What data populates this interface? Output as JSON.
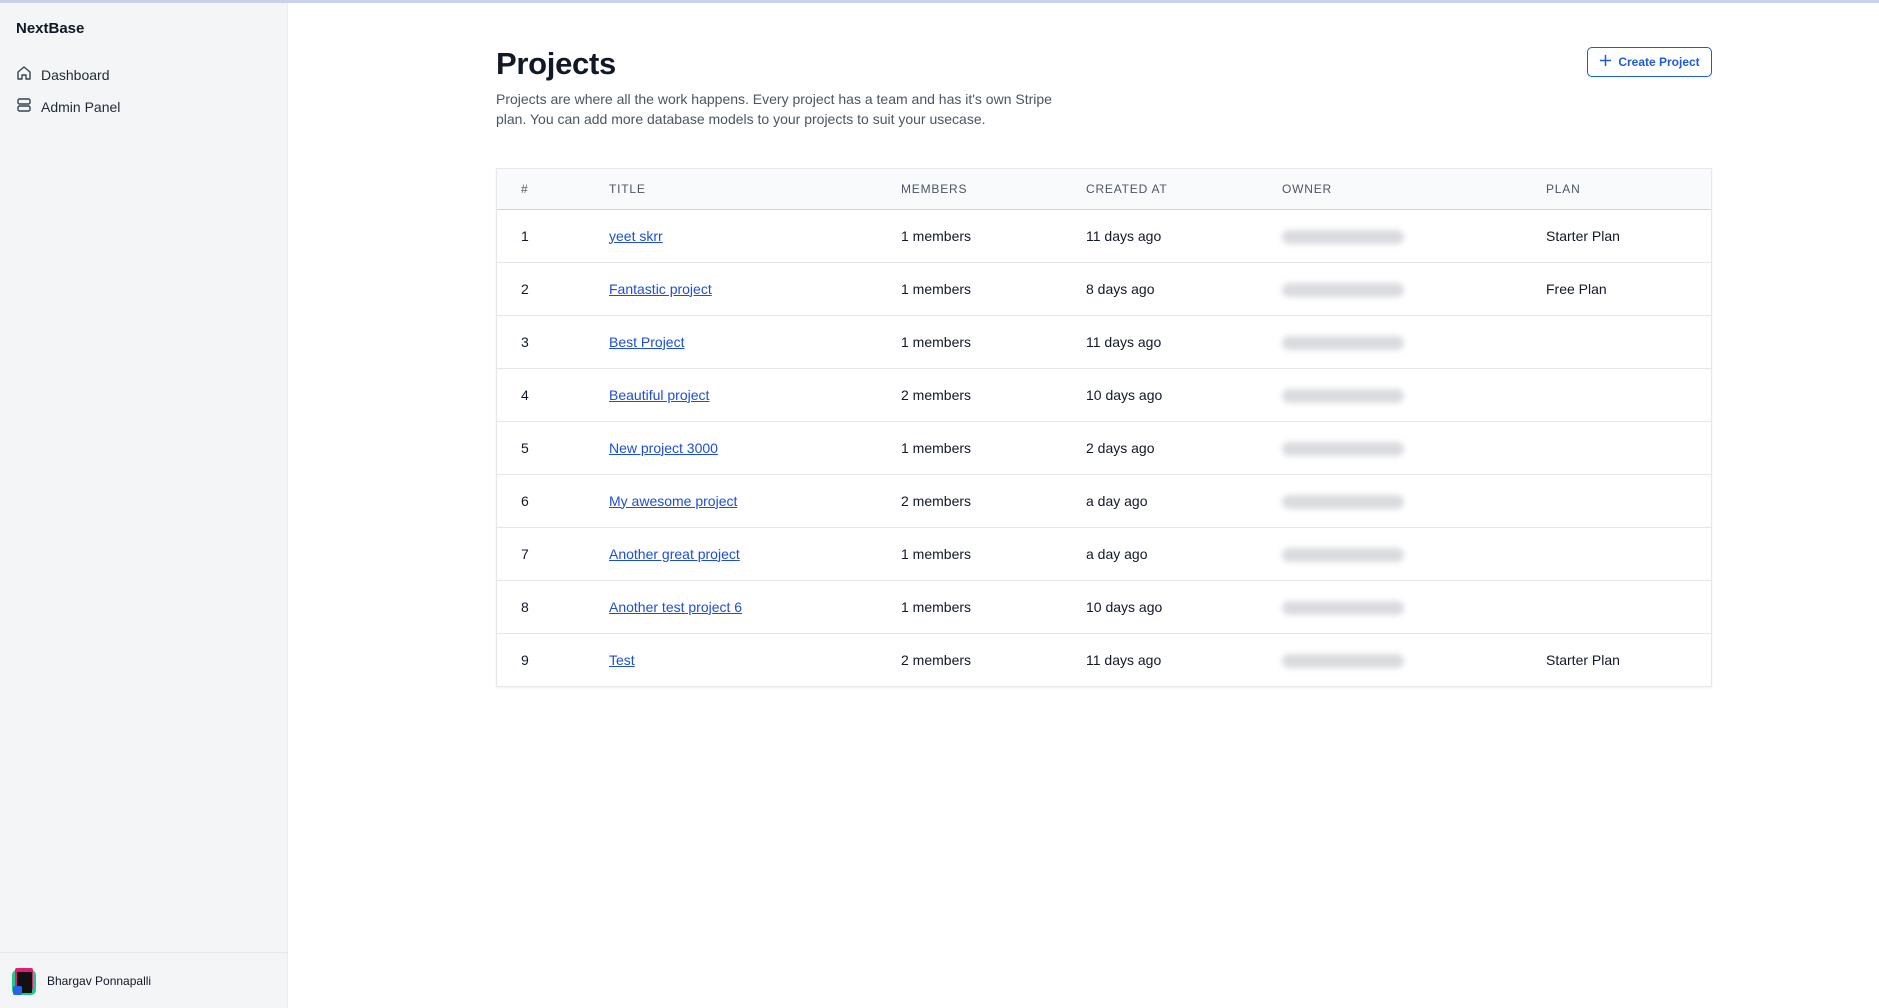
{
  "app": {
    "brand": "NextBase"
  },
  "sidebar": {
    "items": [
      {
        "label": "Dashboard",
        "icon": "home-icon"
      },
      {
        "label": "Admin Panel",
        "icon": "server-icon"
      }
    ],
    "user": {
      "name": "Bhargav Ponnapalli"
    }
  },
  "page": {
    "title": "Projects",
    "description": "Projects are where all the work happens. Every project has a team and has it's own Stripe plan. You can add more database models to your projects to suit your usecase.",
    "create_button": "Create Project"
  },
  "table": {
    "headers": [
      "#",
      "TITLE",
      "MEMBERS",
      "CREATED AT",
      "OWNER",
      "PLAN"
    ],
    "rows": [
      {
        "num": "1",
        "title": "yeet skrr",
        "members": "1 members",
        "created": "11 days ago",
        "plan": "Starter Plan"
      },
      {
        "num": "2",
        "title": "Fantastic project",
        "members": "1 members",
        "created": "8 days ago",
        "plan": "Free Plan"
      },
      {
        "num": "3",
        "title": "Best Project",
        "members": "1 members",
        "created": "11 days ago",
        "plan": ""
      },
      {
        "num": "4",
        "title": "Beautiful project",
        "members": "2 members",
        "created": "10 days ago",
        "plan": ""
      },
      {
        "num": "5",
        "title": "New project 3000",
        "members": "1 members",
        "created": "2 days ago",
        "plan": ""
      },
      {
        "num": "6",
        "title": "My awesome project",
        "members": "2 members",
        "created": "a day ago",
        "plan": ""
      },
      {
        "num": "7",
        "title": "Another great project",
        "members": "1 members",
        "created": "a day ago",
        "plan": ""
      },
      {
        "num": "8",
        "title": "Another test project 6",
        "members": "1 members",
        "created": "10 days ago",
        "plan": ""
      },
      {
        "num": "9",
        "title": "Test",
        "members": "2 members",
        "created": "11 days ago",
        "plan": "Starter Plan"
      }
    ]
  },
  "colors": {
    "accent": "#1e5bd7",
    "link": "#1d4ed8",
    "sidebar_bg": "#f4f5f6"
  }
}
